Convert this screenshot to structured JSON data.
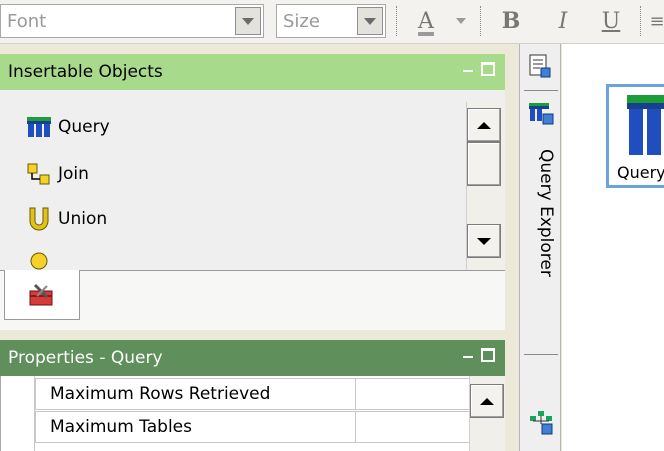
{
  "toolbar": {
    "font_placeholder": "Font",
    "size_placeholder": "Size",
    "font_color_label": "A",
    "bold_label": "B",
    "italic_label": "I",
    "underline_label": "U"
  },
  "insertable_objects": {
    "title": "Insertable Objects",
    "items": [
      {
        "label": "Query",
        "icon": "query-icon"
      },
      {
        "label": "Join",
        "icon": "join-icon"
      },
      {
        "label": "Union",
        "icon": "union-icon"
      }
    ]
  },
  "properties": {
    "title": "Properties - Query",
    "rows": [
      {
        "name": "Maximum Rows Retrieved",
        "value": ""
      },
      {
        "name": "Maximum Tables",
        "value": ""
      }
    ]
  },
  "side_tabs": {
    "query_explorer_label": "Query Explorer"
  },
  "canvas": {
    "node_label": "Query"
  },
  "colors": {
    "insertable_header": "#a8da8c",
    "properties_header": "#5f8f5a",
    "selection_border": "#6aa3dd"
  }
}
